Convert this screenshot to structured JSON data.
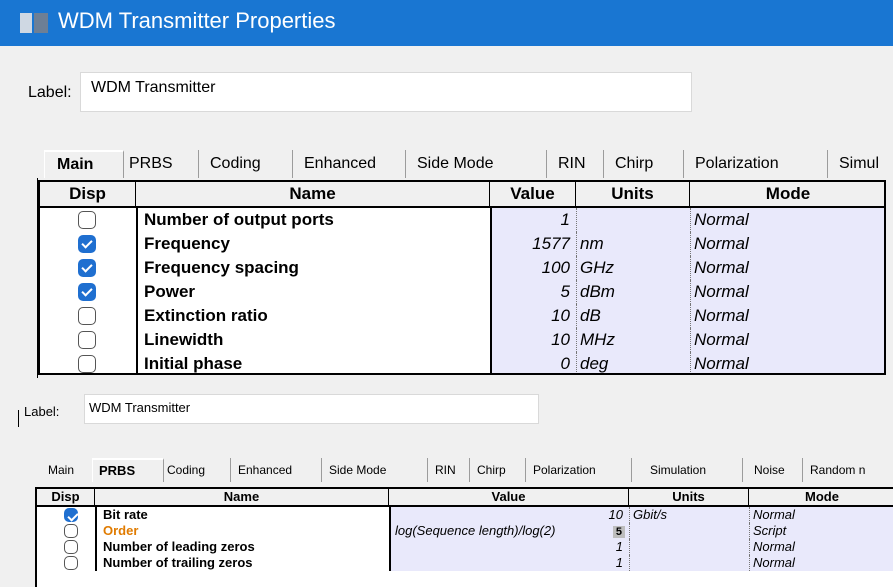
{
  "window": {
    "title": "WDM Transmitter Properties"
  },
  "panel1": {
    "label_caption": "Label:",
    "label_value": "WDM Transmitter",
    "tabs": [
      "Main",
      "PRBS",
      "Coding",
      "Enhanced",
      "Side Mode",
      "RIN",
      "Chirp",
      "Polarization",
      "Simul"
    ],
    "active_tab": "Main",
    "columns": [
      "Disp",
      "Name",
      "Value",
      "Units",
      "Mode"
    ],
    "rows": [
      {
        "disp": false,
        "name": "Number of output ports",
        "value": "1",
        "units": "",
        "mode": "Normal"
      },
      {
        "disp": true,
        "name": "Frequency",
        "value": "1577",
        "units": "nm",
        "mode": "Normal"
      },
      {
        "disp": true,
        "name": "Frequency spacing",
        "value": "100",
        "units": "GHz",
        "mode": "Normal"
      },
      {
        "disp": true,
        "name": "Power",
        "value": "5",
        "units": "dBm",
        "mode": "Normal"
      },
      {
        "disp": false,
        "name": "Extinction ratio",
        "value": "10",
        "units": "dB",
        "mode": "Normal"
      },
      {
        "disp": false,
        "name": "Linewidth",
        "value": "10",
        "units": "MHz",
        "mode": "Normal"
      },
      {
        "disp": false,
        "name": "Initial phase",
        "value": "0",
        "units": "deg",
        "mode": "Normal"
      }
    ]
  },
  "panel2": {
    "label_caption": "Label:",
    "label_value": "WDM Transmitter",
    "tabs": [
      "Main",
      "PRBS",
      "Coding",
      "Enhanced",
      "Side Mode",
      "RIN",
      "Chirp",
      "Polarization",
      "Simulation",
      "Noise",
      "Random n"
    ],
    "active_tab": "PRBS",
    "columns": [
      "Disp",
      "Name",
      "Value",
      "Units",
      "Mode"
    ],
    "rows": [
      {
        "disp": true,
        "name": "Bit rate",
        "value": "10",
        "units": "Gbit/s",
        "mode": "Normal"
      },
      {
        "disp": false,
        "name": "Order",
        "value_expr": "log(Sequence length)/log(2)",
        "value": "5",
        "units": "",
        "mode": "Script"
      },
      {
        "disp": false,
        "name": "Number of leading zeros",
        "value": "1",
        "units": "",
        "mode": "Normal"
      },
      {
        "disp": false,
        "name": "Number of trailing zeros",
        "value": "1",
        "units": "",
        "mode": "Normal"
      }
    ]
  }
}
